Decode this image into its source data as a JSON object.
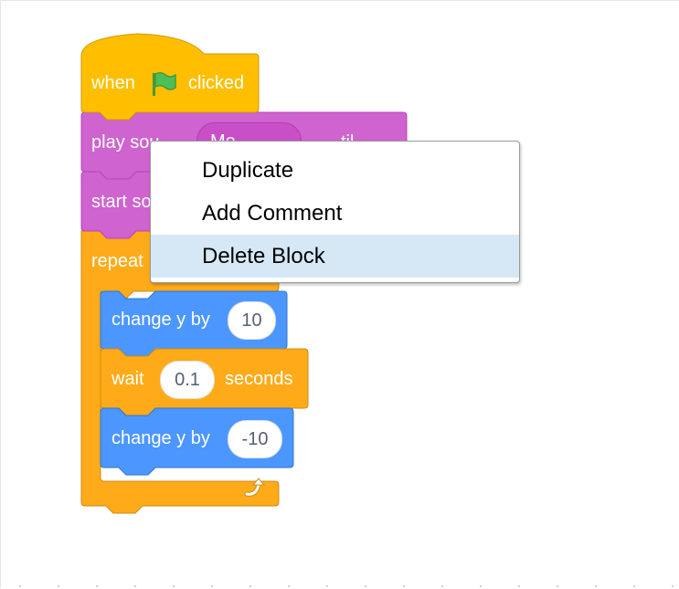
{
  "colors": {
    "events": "#ffbf00",
    "sound": "#cf63cf",
    "control": "#ffab19",
    "motion": "#4c97ff",
    "menu_highlight": "#d6e8f6"
  },
  "blocks": {
    "hat": {
      "when": "when",
      "flag_icon": "green-flag-icon",
      "clicked": "clicked"
    },
    "play_sound": {
      "label": "play sou",
      "sound_name": "Me",
      "tail": "til"
    },
    "start_sound": {
      "label": "start so"
    },
    "repeat": {
      "label": "repeat",
      "arrow_icon": "loop-arrow-icon"
    },
    "change_y_1": {
      "label": "change y by",
      "value": "10"
    },
    "wait": {
      "label": "wait",
      "value": "0.1",
      "suffix": "seconds"
    },
    "change_y_2": {
      "label": "change y by",
      "value": "-10"
    }
  },
  "context_menu": {
    "items": [
      "Duplicate",
      "Add Comment",
      "Delete Block"
    ],
    "highlighted": "Delete Block"
  }
}
